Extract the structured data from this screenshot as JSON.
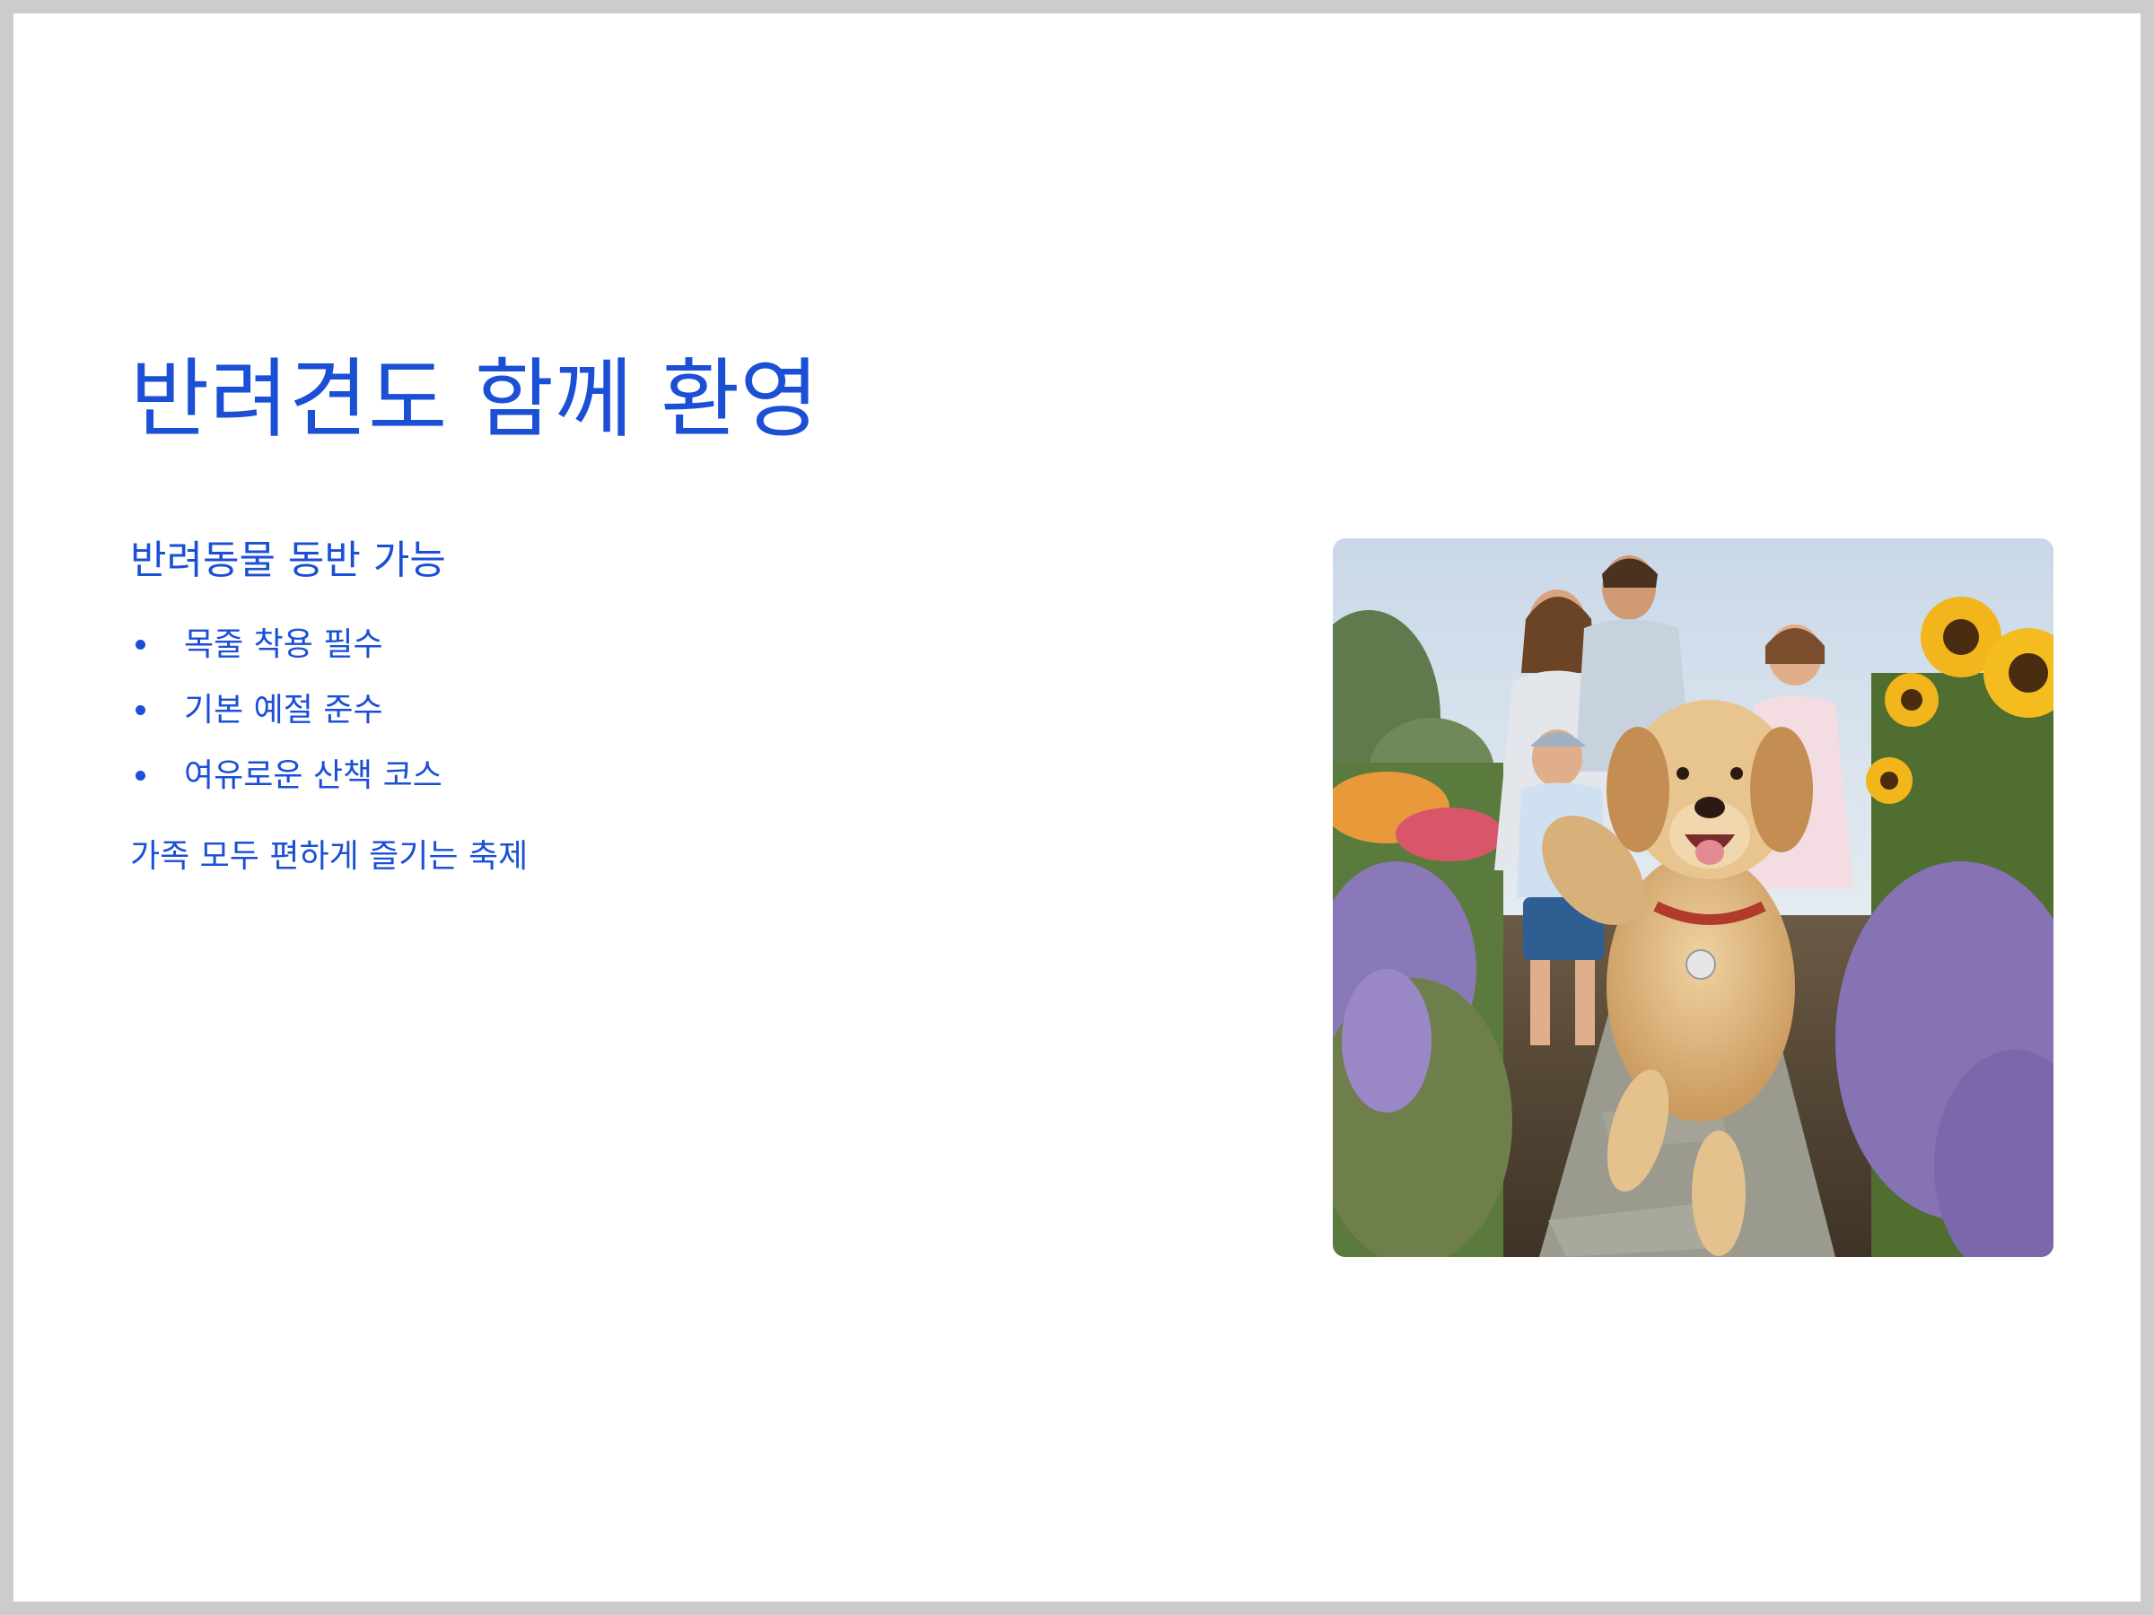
{
  "slide": {
    "title": "반려견도 함께 환영",
    "subtitle": "반려동물 동반 가능",
    "bullets": [
      "목줄 착용 필수",
      "기본 예절 준수",
      "여유로운 산책 코스"
    ],
    "tagline": "가족 모두 편하게 즐기는 축제",
    "accent_color": "#1a4fd6",
    "image_icon": "family-with-golden-retriever-photo"
  }
}
